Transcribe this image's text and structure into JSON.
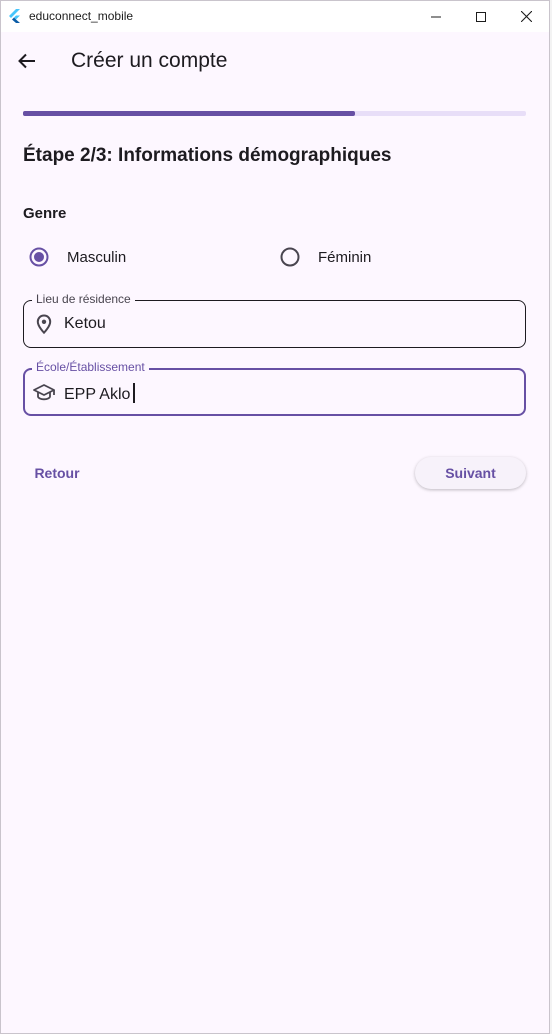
{
  "window": {
    "title": "educonnect_mobile"
  },
  "appbar": {
    "title": "Créer un compte"
  },
  "progress": {
    "current_step": 2,
    "total_steps": 3,
    "fraction": 0.66
  },
  "form": {
    "step_title": "Étape 2/3: Informations démographiques",
    "genre_label": "Genre",
    "genre_options": [
      {
        "label": "Masculin",
        "selected": true
      },
      {
        "label": "Féminin",
        "selected": false
      }
    ],
    "residence": {
      "label": "Lieu de résidence",
      "value": "Ketou",
      "icon": "location-pin-icon"
    },
    "school": {
      "label": "École/Établissement",
      "value": "EPP Aklo",
      "icon": "graduation-cap-icon",
      "focused": true
    }
  },
  "actions": {
    "back_label": "Retour",
    "next_label": "Suivant"
  },
  "colors": {
    "primary": "#6750a4",
    "track": "#e8def8",
    "background": "#fdf7ff"
  }
}
